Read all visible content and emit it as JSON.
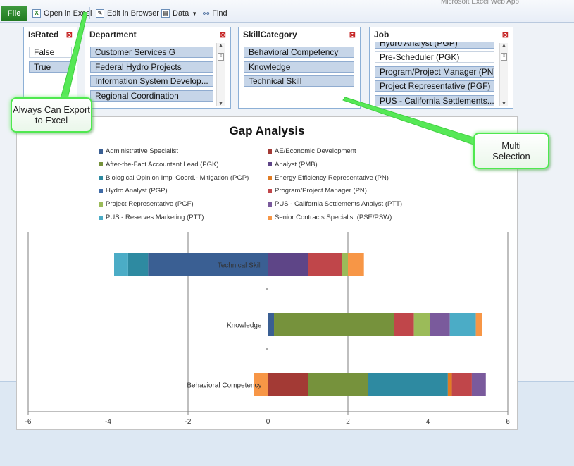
{
  "app": {
    "title": "Microsoft Excel Web App"
  },
  "ribbon": {
    "file_label": "File",
    "open_excel_label": "Open in Excel",
    "edit_browser_label": "Edit in Browser",
    "data_label": "Data",
    "find_label": "Find"
  },
  "slicers": {
    "israted": {
      "title": "IsRated",
      "items": [
        "False",
        "True"
      ]
    },
    "department": {
      "title": "Department",
      "items": [
        "Customer Services G",
        "Federal Hydro Projects",
        "Information System Develop...",
        "Regional Coordination"
      ]
    },
    "skill": {
      "title": "SkillCategory",
      "items": [
        "Behavioral Competency",
        "Knowledge",
        "Technical Skill"
      ]
    },
    "job": {
      "title": "Job",
      "items": [
        "Hydro Analyst (PGP)",
        "Pre-Scheduler (PGK)",
        "Program/Project Manager (PN)",
        "Project Representative (PGF)",
        "PUS - California Settlements..."
      ]
    }
  },
  "callouts": {
    "export": "Always Can Export to Excel",
    "multi": "Multi Selection"
  },
  "chart_data": {
    "type": "bar",
    "orientation": "horizontal",
    "stacked": true,
    "title": "Gap Analysis",
    "categories": [
      "Technical Skill",
      "Knowledge",
      "Behavioral Competency"
    ],
    "xlim": [
      -6,
      6
    ],
    "xticks": [
      -6,
      -4,
      -2,
      0,
      2,
      4,
      6
    ],
    "legend_position": "top",
    "gridlines": "vertical",
    "series": [
      {
        "name": "Administrative Specialist",
        "color": "#3a5f93",
        "values": [
          -3.0,
          0.15,
          0
        ]
      },
      {
        "name": "AE/Economic Development",
        "color": "#a33a35",
        "values": [
          0,
          0,
          1.0
        ]
      },
      {
        "name": "After-the-Fact Accountant Lead (PGK)",
        "color": "#76923c",
        "values": [
          0,
          3.0,
          1.5
        ]
      },
      {
        "name": "Analyst (PMB)",
        "color": "#5e4587",
        "values": [
          1.0,
          0,
          0
        ]
      },
      {
        "name": "Biological Opinion Impl Coord.- Mitigation (PGP)",
        "color": "#2e8aa1",
        "values": [
          -0.5,
          0,
          2.0
        ]
      },
      {
        "name": "Energy Efficiency Representative (PN)",
        "color": "#e07c24",
        "values": [
          0,
          0,
          0.1
        ]
      },
      {
        "name": "Hydro Analyst (PGP)",
        "color": "#3f6aa6",
        "values": [
          0,
          0,
          0
        ]
      },
      {
        "name": "Program/Project Manager (PN)",
        "color": "#c0464a",
        "values": [
          0.85,
          0.5,
          0.5
        ]
      },
      {
        "name": "Project Representative (PGF)",
        "color": "#9bbb59",
        "values": [
          0.15,
          0.4,
          0
        ]
      },
      {
        "name": "PUS - California Settlements Analyst (PTT)",
        "color": "#7a5a9c",
        "values": [
          0,
          0.5,
          0.35
        ]
      },
      {
        "name": "PUS - Reserves Marketing (PTT)",
        "color": "#4bacc6",
        "values": [
          -0.35,
          0.65,
          0
        ]
      },
      {
        "name": "Senior Contracts Specialist (PSE/PSW)",
        "color": "#f79646",
        "values": [
          0.4,
          0.15,
          -0.35
        ]
      }
    ]
  }
}
